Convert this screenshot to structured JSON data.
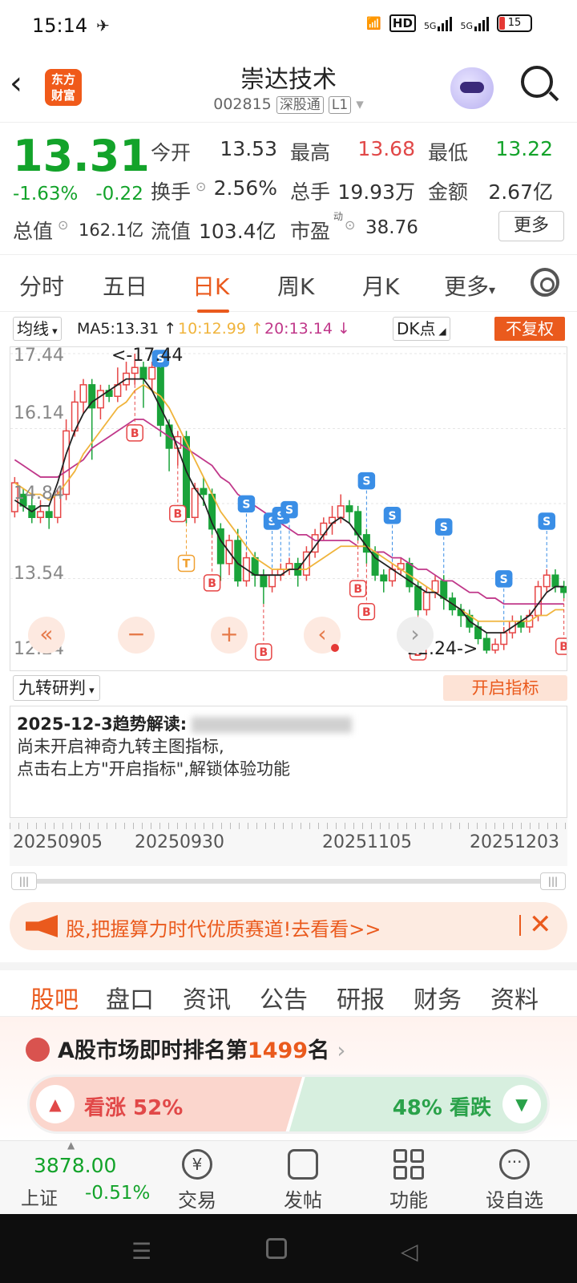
{
  "status": {
    "time": "15:14",
    "battery": "15",
    "hd": "HD",
    "net1": "5G",
    "net2": "5G"
  },
  "header": {
    "logo_line1": "东方",
    "logo_line2": "财富",
    "title": "崇达技术",
    "code": "002815",
    "tag1": "深股通",
    "tag2": "L1"
  },
  "quote": {
    "price": "13.31",
    "change_pct": "-1.63%",
    "change": "-0.22",
    "open_label": "今开",
    "open": "13.53",
    "high_label": "最高",
    "high": "13.68",
    "low_label": "最低",
    "low": "13.22",
    "turnover_label": "换手",
    "turnover": "2.56%",
    "volume_label": "总手",
    "volume": "19.93万",
    "amount_label": "金额",
    "amount": "2.67亿",
    "mktcap_label": "总值",
    "mktcap": "162.1亿",
    "float_label": "流值",
    "float": "103.4亿",
    "pe_label": "市盈",
    "pe": "38.76",
    "pe_sup": "动",
    "more": "更多"
  },
  "ktabs": [
    "分时",
    "五日",
    "日K",
    "周K",
    "月K",
    "更多"
  ],
  "legend": {
    "ma_select": "均线",
    "ma5": "MA5:13.31",
    "ma10": "10:12.99",
    "ma20": "20:13.14",
    "dk": "DK点",
    "restore": "不复权"
  },
  "chart_data": {
    "type": "candlestick",
    "y_ticks": [
      "17.44",
      "16.14",
      "14.84",
      "13.54",
      "12.24"
    ],
    "high_mark": "<-17.44",
    "low_mark": "12.24->",
    "colors": {
      "up": "#e64545",
      "down": "#1aa33a",
      "ma5": "#222222",
      "ma10": "#f0b43c",
      "ma20": "#c0388a"
    },
    "candles": [
      [
        14.7,
        15.2,
        14.6,
        15.3
      ],
      [
        15.0,
        14.8,
        14.7,
        15.1
      ],
      [
        14.8,
        14.6,
        14.5,
        15.0
      ],
      [
        14.6,
        14.7,
        14.5,
        14.9
      ],
      [
        14.7,
        14.6,
        14.4,
        14.8
      ],
      [
        14.6,
        15.0,
        14.5,
        15.1
      ],
      [
        15.0,
        16.1,
        14.9,
        16.3
      ],
      [
        16.1,
        16.6,
        16.0,
        16.8
      ],
      [
        16.6,
        16.9,
        16.4,
        17.0
      ],
      [
        16.9,
        16.5,
        15.6,
        17.0
      ],
      [
        16.5,
        16.8,
        16.3,
        16.9
      ],
      [
        16.8,
        16.7,
        16.6,
        16.9
      ],
      [
        16.7,
        16.9,
        16.6,
        17.2
      ],
      [
        16.9,
        17.1,
        16.8,
        17.3
      ],
      [
        17.1,
        17.2,
        16.9,
        17.44
      ],
      [
        17.2,
        17.0,
        16.5,
        17.3
      ],
      [
        17.0,
        17.2,
        16.8,
        17.3
      ],
      [
        17.2,
        16.2,
        16.0,
        17.3
      ],
      [
        16.2,
        15.8,
        15.4,
        16.3
      ],
      [
        15.8,
        16.0,
        15.5,
        16.1
      ],
      [
        16.0,
        14.6,
        14.5,
        16.1
      ],
      [
        14.6,
        15.1,
        14.5,
        15.2
      ],
      [
        15.1,
        15.0,
        14.8,
        15.3
      ],
      [
        15.0,
        14.4,
        14.3,
        15.1
      ],
      [
        14.4,
        13.8,
        13.5,
        14.5
      ],
      [
        13.8,
        14.2,
        13.6,
        14.3
      ],
      [
        14.2,
        13.5,
        13.4,
        14.4
      ],
      [
        13.5,
        13.9,
        13.4,
        14.0
      ],
      [
        13.9,
        13.6,
        13.4,
        14.0
      ],
      [
        13.6,
        13.4,
        13.1,
        13.7
      ],
      [
        13.4,
        13.6,
        13.3,
        13.7
      ],
      [
        13.6,
        13.7,
        13.5,
        13.8
      ],
      [
        13.7,
        13.8,
        13.6,
        13.9
      ],
      [
        13.8,
        13.6,
        13.4,
        13.9
      ],
      [
        13.6,
        14.0,
        13.5,
        14.1
      ],
      [
        14.0,
        14.3,
        13.9,
        14.4
      ],
      [
        14.3,
        14.5,
        14.2,
        14.6
      ],
      [
        14.5,
        14.6,
        14.3,
        14.8
      ],
      [
        14.6,
        14.8,
        14.5,
        15.0
      ],
      [
        14.8,
        14.7,
        14.5,
        14.9
      ],
      [
        14.7,
        14.3,
        14.2,
        14.8
      ],
      [
        14.3,
        14.0,
        13.8,
        14.4
      ],
      [
        14.0,
        13.6,
        13.5,
        14.1
      ],
      [
        13.6,
        13.5,
        13.3,
        13.7
      ],
      [
        13.5,
        13.7,
        13.4,
        13.8
      ],
      [
        13.7,
        13.8,
        13.6,
        13.9
      ],
      [
        13.8,
        13.4,
        13.3,
        13.9
      ],
      [
        13.4,
        13.0,
        12.9,
        13.5
      ],
      [
        13.0,
        13.3,
        12.9,
        13.4
      ],
      [
        13.3,
        13.5,
        13.2,
        13.6
      ],
      [
        13.5,
        13.2,
        13.0,
        13.6
      ],
      [
        13.2,
        13.0,
        12.9,
        13.3
      ],
      [
        13.0,
        12.9,
        12.7,
        13.1
      ],
      [
        12.9,
        12.7,
        12.6,
        13.0
      ],
      [
        12.7,
        12.5,
        12.4,
        12.8
      ],
      [
        12.5,
        12.3,
        12.24,
        12.6
      ],
      [
        12.3,
        12.4,
        12.24,
        12.5
      ],
      [
        12.4,
        12.6,
        12.3,
        12.7
      ],
      [
        12.6,
        12.8,
        12.5,
        12.9
      ],
      [
        12.8,
        12.7,
        12.6,
        12.9
      ],
      [
        12.7,
        12.9,
        12.6,
        13.0
      ],
      [
        12.9,
        13.4,
        12.8,
        13.5
      ],
      [
        13.4,
        13.6,
        13.3,
        13.7
      ],
      [
        13.6,
        13.4,
        13.3,
        13.7
      ],
      [
        13.4,
        13.3,
        13.2,
        13.5
      ]
    ],
    "ma5": [
      14.9,
      14.8,
      14.7,
      14.8,
      14.8,
      15.2,
      15.7,
      16.1,
      16.4,
      16.6,
      16.7,
      16.8,
      16.9,
      17.0,
      17.0,
      17.0,
      16.8,
      16.5,
      16.2,
      15.8,
      15.4,
      15.1,
      14.9,
      14.5,
      14.2,
      14.0,
      13.8,
      13.7,
      13.6,
      13.6,
      13.6,
      13.6,
      13.7,
      13.7,
      13.9,
      14.1,
      14.3,
      14.5,
      14.6,
      14.5,
      14.3,
      14.1,
      13.9,
      13.8,
      13.7,
      13.6,
      13.5,
      13.4,
      13.3,
      13.3,
      13.2,
      13.1,
      13.0,
      12.8,
      12.7,
      12.6,
      12.6,
      12.6,
      12.7,
      12.8,
      12.9,
      13.1,
      13.3,
      13.4,
      13.4
    ],
    "ma10": [
      15.2,
      15.1,
      15.0,
      15.0,
      14.9,
      15.0,
      15.2,
      15.4,
      15.7,
      15.9,
      16.1,
      16.3,
      16.5,
      16.6,
      16.8,
      16.9,
      16.8,
      16.7,
      16.5,
      16.2,
      15.9,
      15.6,
      15.3,
      15.0,
      14.7,
      14.5,
      14.3,
      14.1,
      13.9,
      13.8,
      13.7,
      13.7,
      13.7,
      13.7,
      13.7,
      13.8,
      13.9,
      14.0,
      14.1,
      14.1,
      14.1,
      14.1,
      14.0,
      13.9,
      13.8,
      13.7,
      13.6,
      13.5,
      13.4,
      13.3,
      13.2,
      13.1,
      13.0,
      12.9,
      12.8,
      12.8,
      12.8,
      12.8,
      12.8,
      12.8,
      12.8,
      12.9,
      12.9,
      13.0,
      13.0
    ],
    "ma20": [
      15.6,
      15.5,
      15.4,
      15.3,
      15.3,
      15.3,
      15.4,
      15.5,
      15.6,
      15.8,
      15.9,
      16.0,
      16.1,
      16.2,
      16.3,
      16.3,
      16.2,
      16.1,
      16.0,
      15.9,
      15.8,
      15.7,
      15.6,
      15.5,
      15.3,
      15.2,
      15.0,
      14.9,
      14.8,
      14.7,
      14.6,
      14.5,
      14.4,
      14.3,
      14.3,
      14.2,
      14.2,
      14.2,
      14.2,
      14.2,
      14.1,
      14.1,
      14.0,
      14.0,
      13.9,
      13.9,
      13.8,
      13.7,
      13.7,
      13.6,
      13.5,
      13.5,
      13.4,
      13.3,
      13.3,
      13.2,
      13.2,
      13.1,
      13.1,
      13.1,
      13.1,
      13.1,
      13.1,
      13.1,
      13.1
    ],
    "signals": [
      {
        "type": "B",
        "i": 14
      },
      {
        "type": "S",
        "i": 17
      },
      {
        "type": "B",
        "i": 19
      },
      {
        "type": "T",
        "i": 20
      },
      {
        "type": "B",
        "i": 23
      },
      {
        "type": "S",
        "i": 27
      },
      {
        "type": "B",
        "i": 29
      },
      {
        "type": "S",
        "i": 30
      },
      {
        "type": "S",
        "i": 31
      },
      {
        "type": "S",
        "i": 32
      },
      {
        "type": "S",
        "i": 41
      },
      {
        "type": "B",
        "i": 41
      },
      {
        "type": "S",
        "i": 44
      },
      {
        "type": "B",
        "i": 40
      },
      {
        "type": "B",
        "i": 47
      },
      {
        "type": "S",
        "i": 50
      },
      {
        "type": "S",
        "i": 57
      },
      {
        "type": "S",
        "i": 62
      },
      {
        "type": "B",
        "i": 64
      }
    ]
  },
  "jiuzhuan": {
    "select": "九转研判",
    "open_btn": "开启指标",
    "head": "2025-12-3趋势解读:",
    "line1": "尚未开启神奇九转主图指标,",
    "line2": "点击右上方\"开启指标\",解锁体验功能"
  },
  "dates": [
    "20250905",
    "20250930",
    "20251105",
    "20251203"
  ],
  "banner": {
    "text": "股,把握算力时代优质赛道!去看看>>"
  },
  "feedtabs": [
    "股吧",
    "盘口",
    "资讯",
    "公告",
    "研报",
    "财务",
    "资料"
  ],
  "rank": {
    "prefix": "A股市场即时排名第",
    "num": "1499",
    "suffix": "名"
  },
  "vote": {
    "up": "看涨 52%",
    "down": "48% 看跌"
  },
  "bottomnav": {
    "index_value": "3878.00",
    "index_name": "上证",
    "index_change": "-0.51%",
    "items": [
      "交易",
      "发帖",
      "功能",
      "设自选"
    ]
  }
}
